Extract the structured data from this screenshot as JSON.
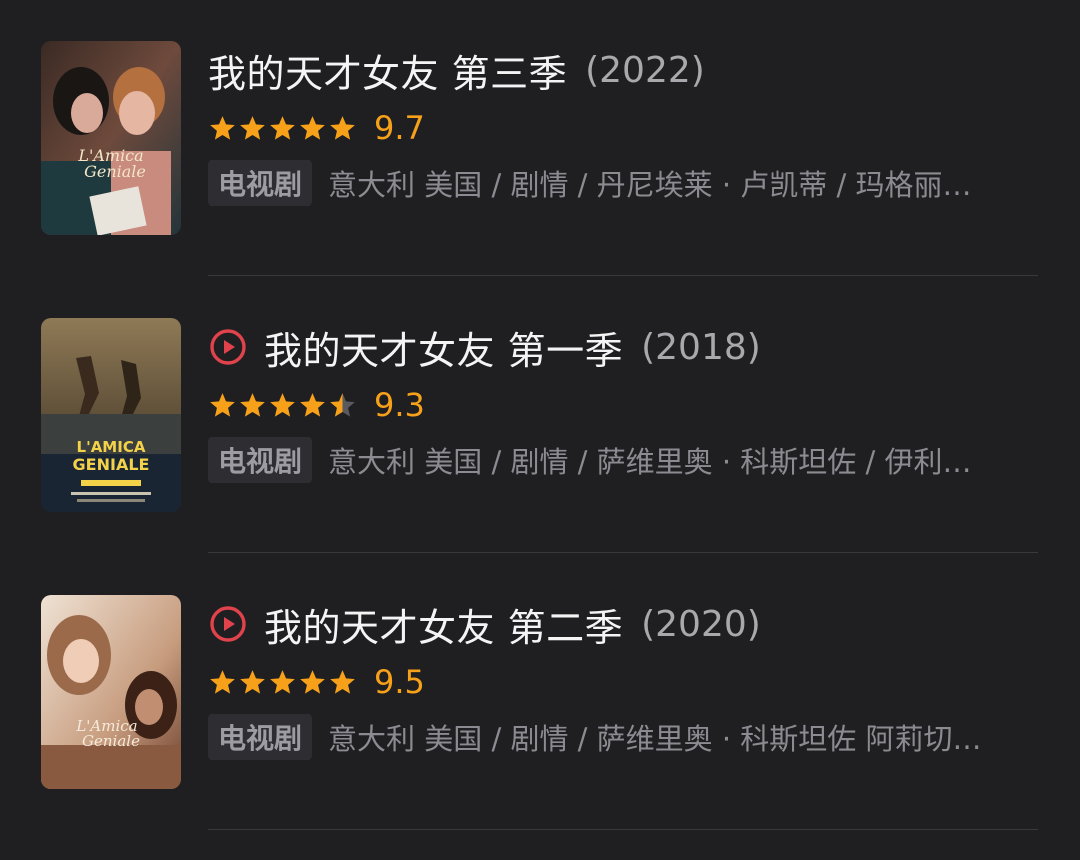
{
  "items": [
    {
      "title": "我的天才女友 第三季",
      "year": "(2022)",
      "rating": 9.7,
      "stars": 5,
      "rating_text": "9.7",
      "badge": "电视剧",
      "meta": "意大利 美国 / 剧情 / 丹尼埃莱 · 卢凯蒂 / 玛格丽…",
      "has_play": false,
      "poster_text": "L'Amica Geniale"
    },
    {
      "title": "我的天才女友 第一季",
      "year": "(2018)",
      "rating": 9.3,
      "stars": 4.5,
      "rating_text": "9.3",
      "badge": "电视剧",
      "meta": "意大利 美国 / 剧情 / 萨维里奥 · 科斯坦佐 / 伊利…",
      "has_play": true,
      "poster_text": "L'AMICA GENIALE"
    },
    {
      "title": "我的天才女友 第二季",
      "year": "(2020)",
      "rating": 9.5,
      "stars": 5,
      "rating_text": "9.5",
      "badge": "电视剧",
      "meta": "意大利 美国 / 剧情 / 萨维里奥 · 科斯坦佐 阿莉切…",
      "has_play": true,
      "poster_text": "L'Amica Geniale"
    }
  ],
  "colors": {
    "background": "#1f1f22",
    "star": "#f7a11a",
    "star_empty": "#5a5a5e",
    "play": "#e0434b",
    "year": "#a9a9ad",
    "meta": "#8b8b91"
  },
  "icons": {
    "play": "play-circle-icon",
    "star": "star-icon"
  }
}
